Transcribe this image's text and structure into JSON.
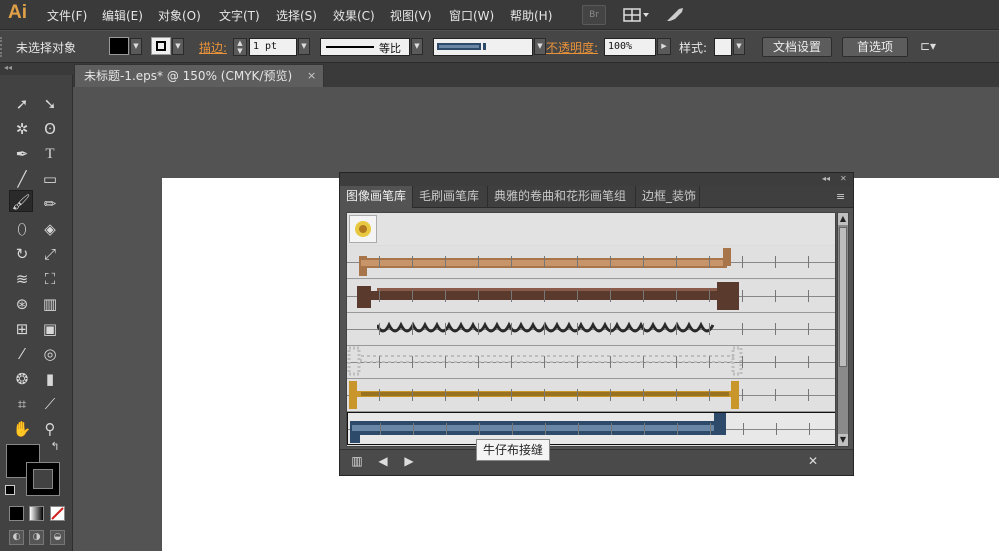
{
  "app": {
    "logo": "Ai"
  },
  "menu": {
    "items": [
      "文件(F)",
      "编辑(E)",
      "对象(O)",
      "文字(T)",
      "选择(S)",
      "效果(C)",
      "视图(V)",
      "窗口(W)",
      "帮助(H)"
    ],
    "bridge_label": "Br"
  },
  "control_bar": {
    "selection_status": "未选择对象",
    "stroke_label": "描边:",
    "stroke_weight": "1 pt",
    "profile_label": "等比",
    "opacity_label": "不透明度:",
    "opacity_value": "100%",
    "style_label": "样式:",
    "doc_setup_button": "文档设置",
    "preferences_button": "首选项"
  },
  "document": {
    "tab_title": "未标题-1.eps* @ 150% (CMYK/预览)",
    "close_glyph": "×"
  },
  "toolbox": {
    "grip": "◂◂"
  },
  "panel": {
    "collapse_glyph": "◂◂",
    "close_glyph": "✕",
    "menu_glyph": "≡",
    "tabs": [
      "图像画笔库",
      "毛刷画笔库",
      "典雅的卷曲和花形画笔组",
      "边框_装饰"
    ],
    "active_tab": 0,
    "tooltip": "牛仔布接缝",
    "colors": {
      "rope": "#a8744a",
      "chain": "#5a3a2c",
      "coil": "#2a2a2a",
      "dots": "#bdbdbd",
      "gold": "#c8962a",
      "denim": "#2e4a6a"
    }
  }
}
